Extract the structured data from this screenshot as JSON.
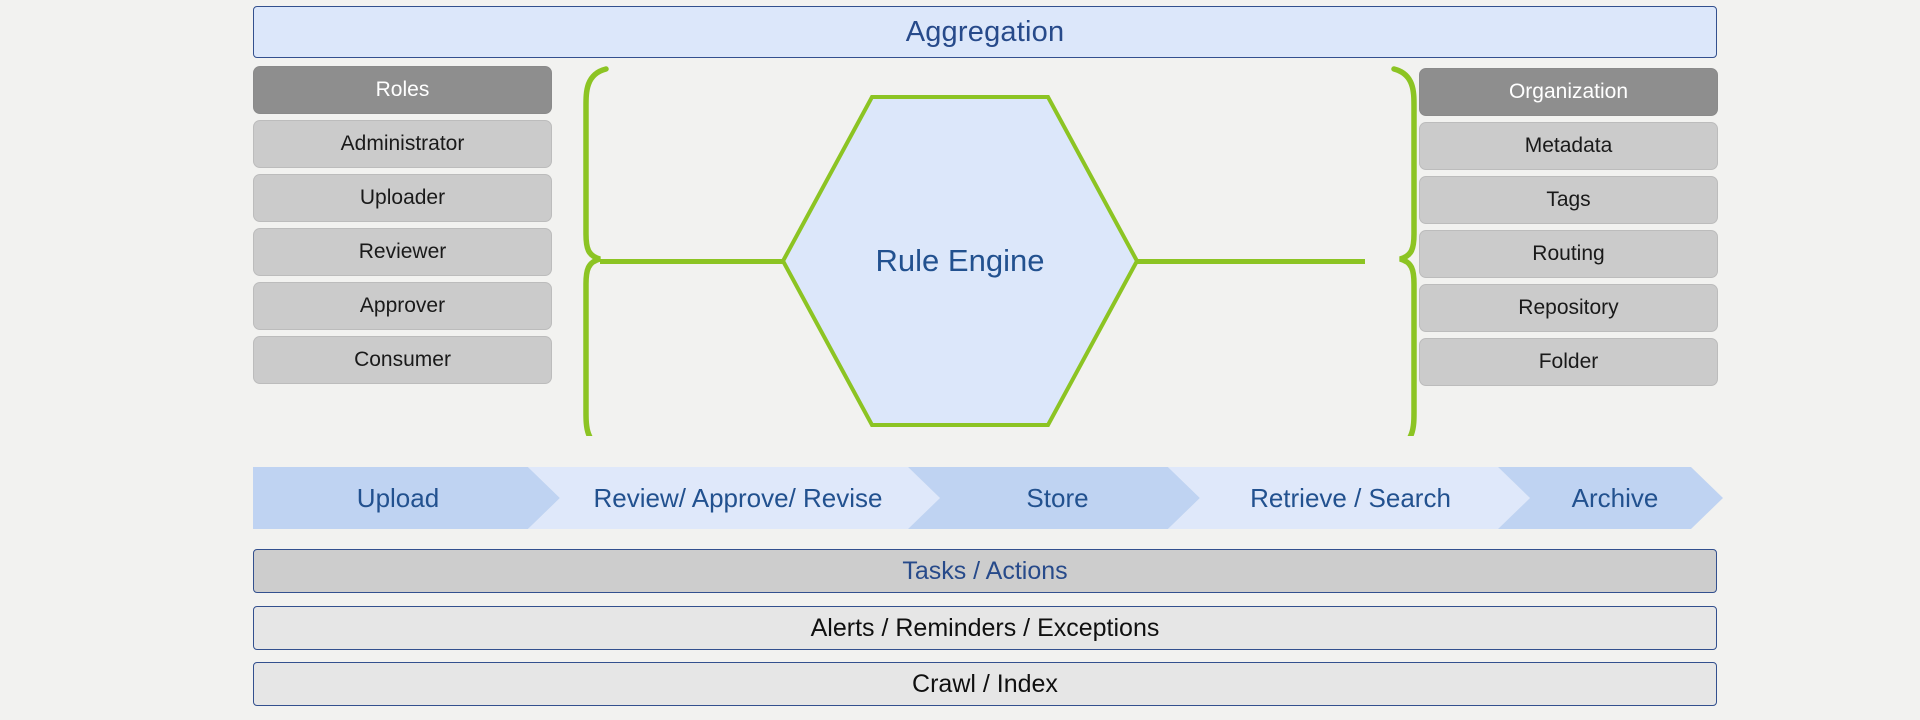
{
  "banner": {
    "title": "Aggregation"
  },
  "colors": {
    "banner_fill": "#dce7fa",
    "banner_border": "#33508e",
    "banner_text": "#274a8a",
    "chip_header_fill": "#8e8e8e",
    "chip_item_fill": "#cbcbcb",
    "brace_green": "#8cc423",
    "hex_fill": "#dce7fa",
    "hex_stroke": "#8cc423",
    "chevron_dark": "#bfd3f2",
    "chevron_light": "#dfe8fa",
    "chevron_text": "#22518f"
  },
  "left_column": {
    "header": "Roles",
    "items": [
      "Administrator",
      "Uploader",
      "Reviewer",
      "Approver",
      "Consumer"
    ]
  },
  "right_column": {
    "header": "Organization",
    "items": [
      "Metadata",
      "Tags",
      "Routing",
      "Repository",
      "Folder"
    ]
  },
  "center": {
    "label": "Rule Engine"
  },
  "flow": {
    "steps": [
      {
        "label": "Upload",
        "shade": "dark"
      },
      {
        "label": "Review/ Approve/ Revise",
        "shade": "light"
      },
      {
        "label": "Store",
        "shade": "dark"
      },
      {
        "label": "Retrieve / Search",
        "shade": "light"
      },
      {
        "label": "Archive",
        "shade": "dark"
      }
    ]
  },
  "bottom_bars": [
    "Tasks / Actions",
    "Alerts / Reminders / Exceptions",
    "Crawl / Index"
  ]
}
